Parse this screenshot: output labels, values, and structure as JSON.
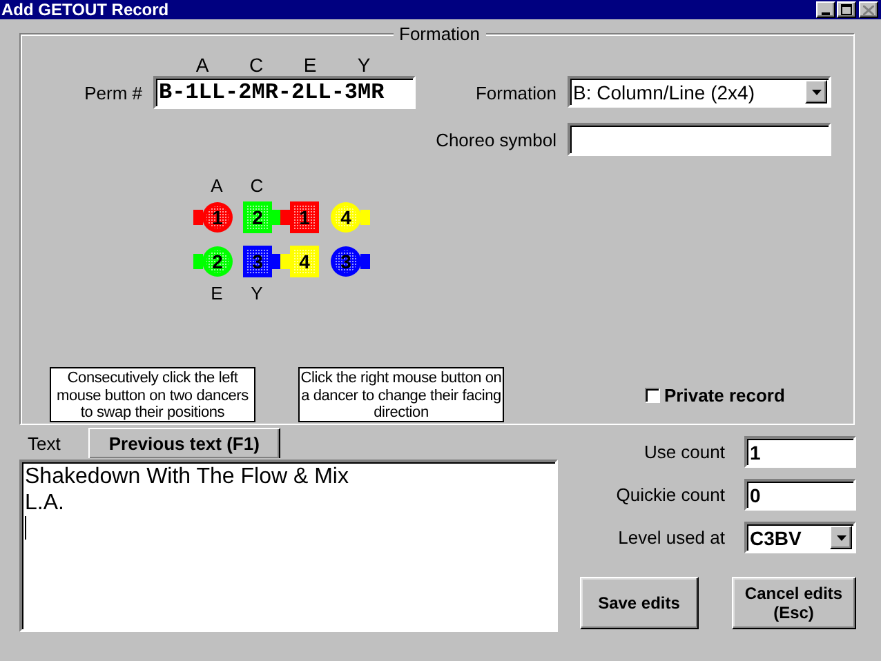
{
  "window": {
    "title": "Add GETOUT Record"
  },
  "formation_group": {
    "title": "Formation",
    "perm_letters": [
      "A",
      "C",
      "E",
      "Y"
    ],
    "perm": {
      "label": "Perm #",
      "value": "B-1LL-2MR-2LL-3MR"
    },
    "formation": {
      "label": "Formation",
      "value": "B: Column/Line (2x4)"
    },
    "choreo_symbol": {
      "label": "Choreo symbol"
    },
    "diagram": {
      "top_labels": [
        "A",
        "C"
      ],
      "bottom_labels": [
        "E",
        "Y"
      ],
      "rows": [
        [
          {
            "kind": "round",
            "color": "#ff0000",
            "number": "1",
            "facing_left": true
          },
          {
            "kind": "square",
            "color": "#00ff00",
            "number": "2",
            "facing_left": false
          },
          {
            "kind": "square",
            "color": "#ff0000",
            "number": "1",
            "facing_left": true
          },
          {
            "kind": "round",
            "color": "#ffff00",
            "number": "4",
            "facing_left": false
          }
        ],
        [
          {
            "kind": "round",
            "color": "#00ff00",
            "number": "2",
            "facing_left": true
          },
          {
            "kind": "square",
            "color": "#0000ff",
            "number": "3",
            "facing_left": false
          },
          {
            "kind": "square",
            "color": "#ffff00",
            "number": "4",
            "facing_left": true
          },
          {
            "kind": "round",
            "color": "#0000ff",
            "number": "3",
            "facing_left": false
          }
        ]
      ]
    },
    "hints": [
      "Consecutively click the left mouse button on two dancers to swap their positions",
      "Click the right mouse button on a dancer to change their facing direction"
    ],
    "private_record": {
      "label": "Private record",
      "checked": false
    }
  },
  "tabs": [
    {
      "label": "Text",
      "selected": true
    },
    {
      "label": "Previous text  (F1)",
      "selected": false
    }
  ],
  "text_area": {
    "lines": [
      "Shakedown With The Flow & Mix",
      "L.A."
    ]
  },
  "use_count": {
    "label": "Use count",
    "value": "1"
  },
  "quickie_count": {
    "label": "Quickie count",
    "value": "0"
  },
  "level_used_at": {
    "label": "Level used at",
    "value": "C3BV"
  },
  "buttons": [
    "Save edits",
    "Cancel edits (Esc)"
  ]
}
